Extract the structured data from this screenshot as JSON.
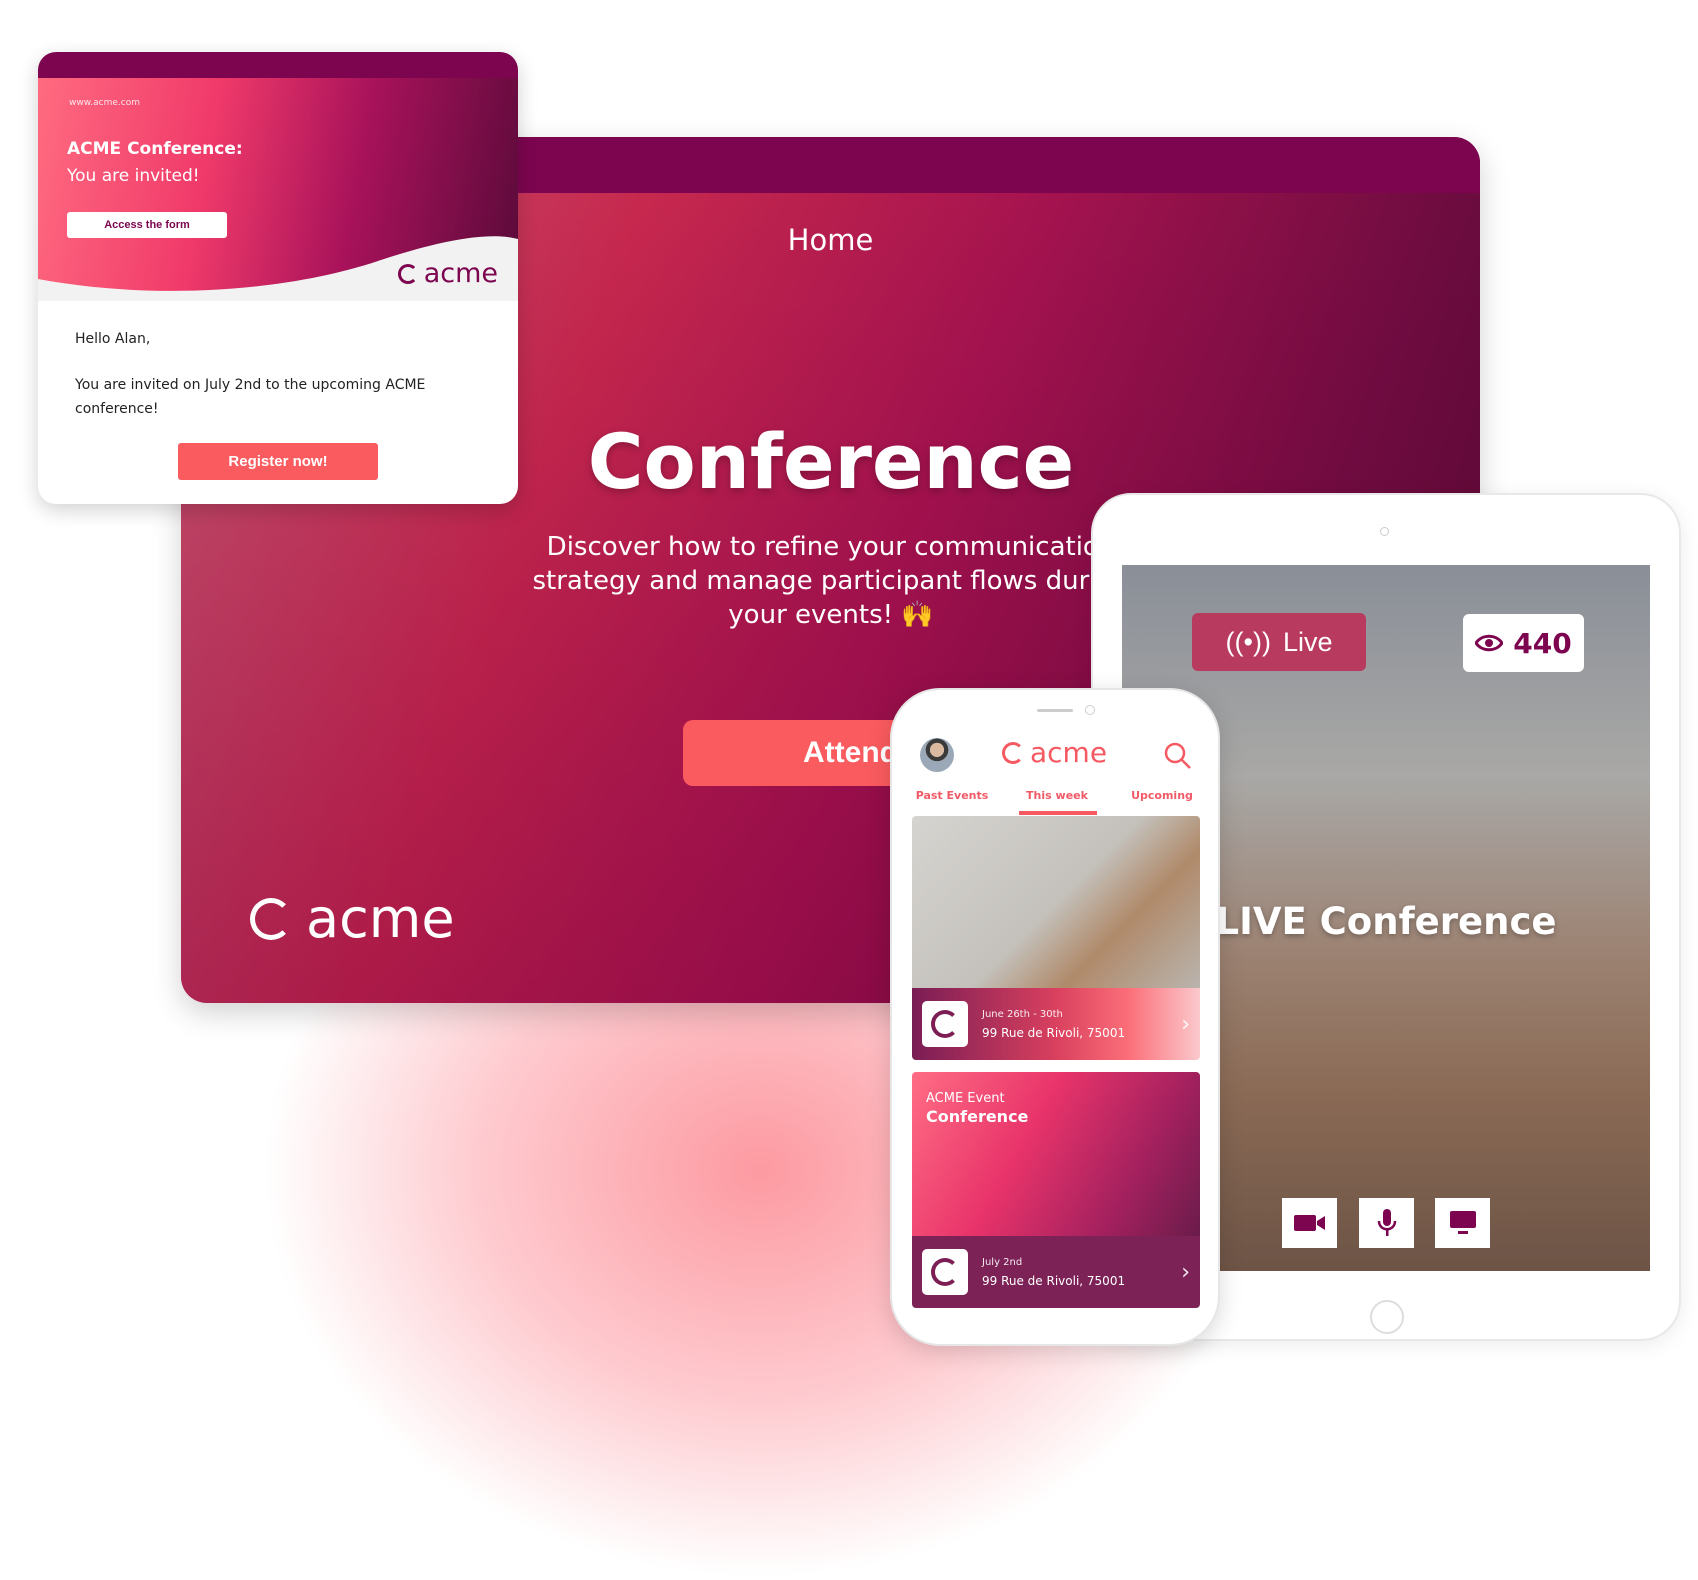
{
  "website": {
    "nav_title": "Home",
    "title": "Conference",
    "subtitle": "Discover how to refine your communication strategy and manage participant flows during your events! 🙌",
    "attend_label": "Attend",
    "logo_text": "acme"
  },
  "email": {
    "url": "www.acme.com",
    "title_line1": "ACME Conference:",
    "title_line2": "You are invited!",
    "form_button": "Access the form",
    "logo_text": "acme",
    "greeting": "Hello Alan,",
    "body": "You are invited on July 2nd to the upcoming ACME conference!",
    "register_button": "Register now!"
  },
  "tablet": {
    "live_label": "Live",
    "viewer_count": "440",
    "stream_title": "LIVE Conference",
    "controls": [
      "camera-icon",
      "microphone-icon",
      "screen-share-icon"
    ]
  },
  "phone": {
    "logo_text": "acme",
    "tabs": [
      {
        "label": "Past Events",
        "active": false
      },
      {
        "label": "This week",
        "active": true
      },
      {
        "label": "Upcoming",
        "active": false
      }
    ],
    "events": [
      {
        "date": "June 26th - 30th",
        "address": "99 Rue de Rivoli, 75001"
      },
      {
        "kicker": "ACME Event",
        "title": "Conference",
        "date": "July 2nd",
        "address": "99 Rue de Rivoli, 75001"
      }
    ]
  },
  "colors": {
    "brand_purple": "#7d0550",
    "accent_coral": "#fa5b5f"
  }
}
